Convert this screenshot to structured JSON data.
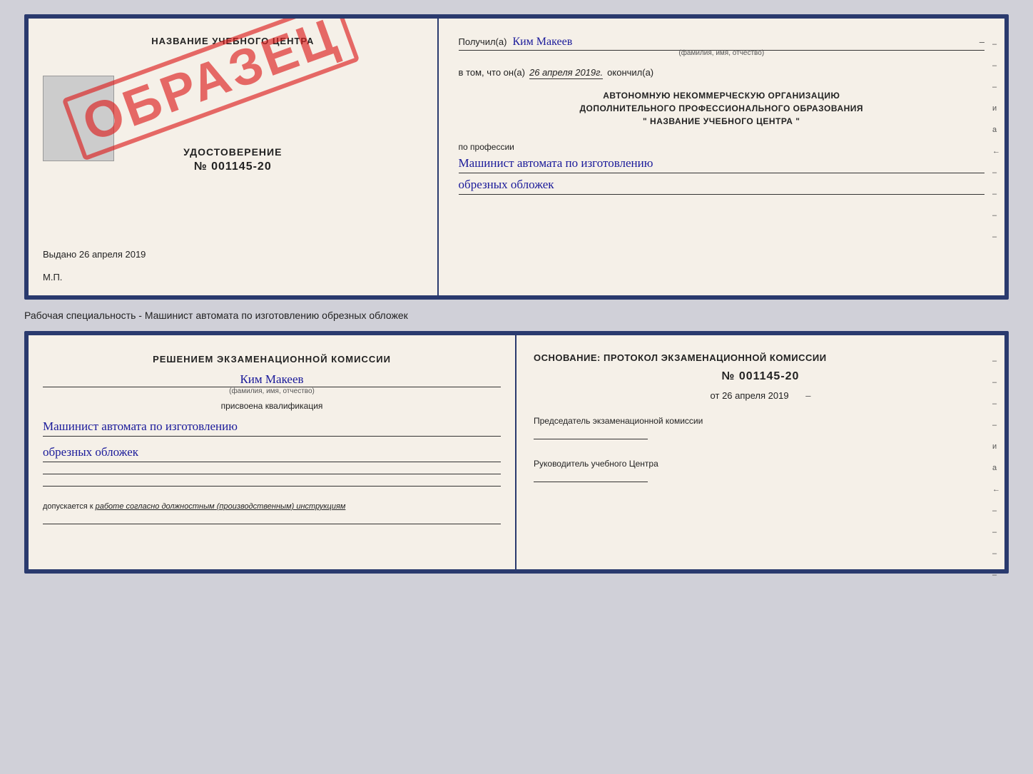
{
  "top_doc": {
    "left": {
      "school_name": "НАЗВАНИЕ УЧЕБНОГО ЦЕНТРА",
      "udostoverenie_label": "УДОСТОВЕРЕНИЕ",
      "udostoverenie_number": "№ 001145-20",
      "vydano_label": "Выдано",
      "vydano_date": "26 апреля 2019",
      "mp_label": "М.П.",
      "stamp_text": "ОБРАЗЕЦ"
    },
    "right": {
      "poluchil_label": "Получил(а)",
      "poluchil_name": "Ким Макеев",
      "fio_hint": "(фамилия, имя, отчество)",
      "vtom_prefix": "в том, что он(а)",
      "vtom_date": "26 апреля 2019г.",
      "okonchil": "окончил(а)",
      "org_line1": "АВТОНОМНУЮ НЕКОММЕРЧЕСКУЮ ОРГАНИЗАЦИЮ",
      "org_line2": "ДОПОЛНИТЕЛЬНОГО ПРОФЕССИОНАЛЬНОГО ОБРАЗОВАНИЯ",
      "school_quote": "\"  НАЗВАНИЕ УЧЕБНОГО ЦЕНТРА  \"",
      "po_professii": "по профессии",
      "profession_line1": "Машинист автомата по изготовлению",
      "profession_line2": "обрезных обложек"
    }
  },
  "middle": {
    "text": "Рабочая специальность - Машинист автомата по изготовлению обрезных обложек"
  },
  "bottom_doc": {
    "left": {
      "resheniem_title": "Решением экзаменационной комиссии",
      "name": "Ким Макеев",
      "fio_hint": "(фамилия, имя, отчество)",
      "prisvоена": "присвоена квалификация",
      "profession_line1": "Машинист автомата по изготовлению",
      "profession_line2": "обрезных обложек",
      "dopuskaetsya_prefix": "допускается к",
      "dopuskaetsya_text": "работе согласно должностным (производственным) инструкциям"
    },
    "right": {
      "osnovanie_label": "Основание: протокол экзаменационной комиссии",
      "number": "№  001145-20",
      "ot_label": "от",
      "ot_date": "26 апреля 2019",
      "predsedatel_label": "Председатель экзаменационной комиссии",
      "rukovoditel_label": "Руководитель учебного Центра"
    }
  },
  "side_marks": [
    "-",
    "-",
    "и",
    "а",
    "←",
    "-",
    "-",
    "-"
  ]
}
